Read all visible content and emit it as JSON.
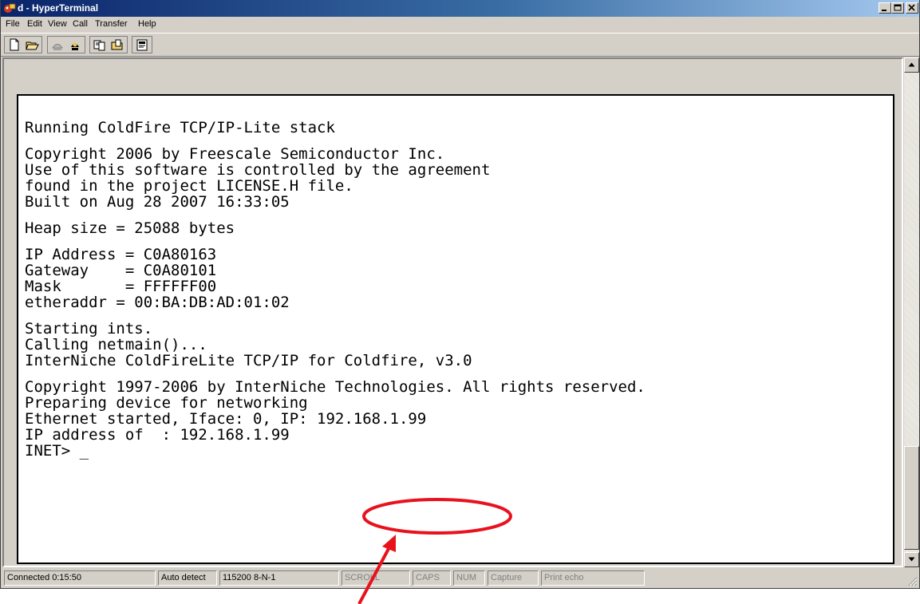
{
  "window": {
    "title": "d - HyperTerminal",
    "app_icon": "hyperterminal-icon",
    "controls": [
      "minimize-icon",
      "maximize-icon",
      "close-icon"
    ]
  },
  "menu": {
    "items": [
      "File",
      "Edit",
      "View",
      "Call",
      "Transfer",
      "Help"
    ]
  },
  "toolbar": {
    "buttons": [
      "new-icon",
      "open-icon",
      "call-icon",
      "disconnect-icon",
      "send-icon",
      "receive-icon",
      "properties-icon"
    ]
  },
  "terminal": {
    "lines": [
      "Running ColdFire TCP/IP-Lite stack",
      "Copyright 2006 by Freescale Semiconductor Inc.",
      "Use of this software is controlled by the agreement",
      "found in the project LICENSE.H file.",
      "Built on Aug 28 2007 16:33:05",
      "Heap size = 25088 bytes",
      "IP Address = C0A80163",
      "Gateway    = C0A80101",
      "Mask       = FFFFFF00",
      "etheraddr = 00:BA:DB:AD:01:02",
      "Starting ints.",
      "Calling netmain()...",
      "InterNiche ColdFireLite TCP/IP for Coldfire, v3.0",
      "Copyright 1997-2006 by InterNiche Technologies. All rights reserved.",
      "Preparing device for networking",
      "Ethernet started, Iface: 0, IP: 192.168.1.99",
      "IP address of  : 192.168.1.99",
      "INET> _"
    ]
  },
  "statusbar": {
    "connected": "Connected 0:15:50",
    "detect": "Auto detect",
    "settings": "115200 8-N-1",
    "scroll": "SCROLL",
    "caps": "CAPS",
    "num": "NUM",
    "capture": "Capture",
    "print_echo": "Print echo"
  },
  "annotation": {
    "color": "#e8121d",
    "highlighted_text": "192.168.1.99"
  }
}
